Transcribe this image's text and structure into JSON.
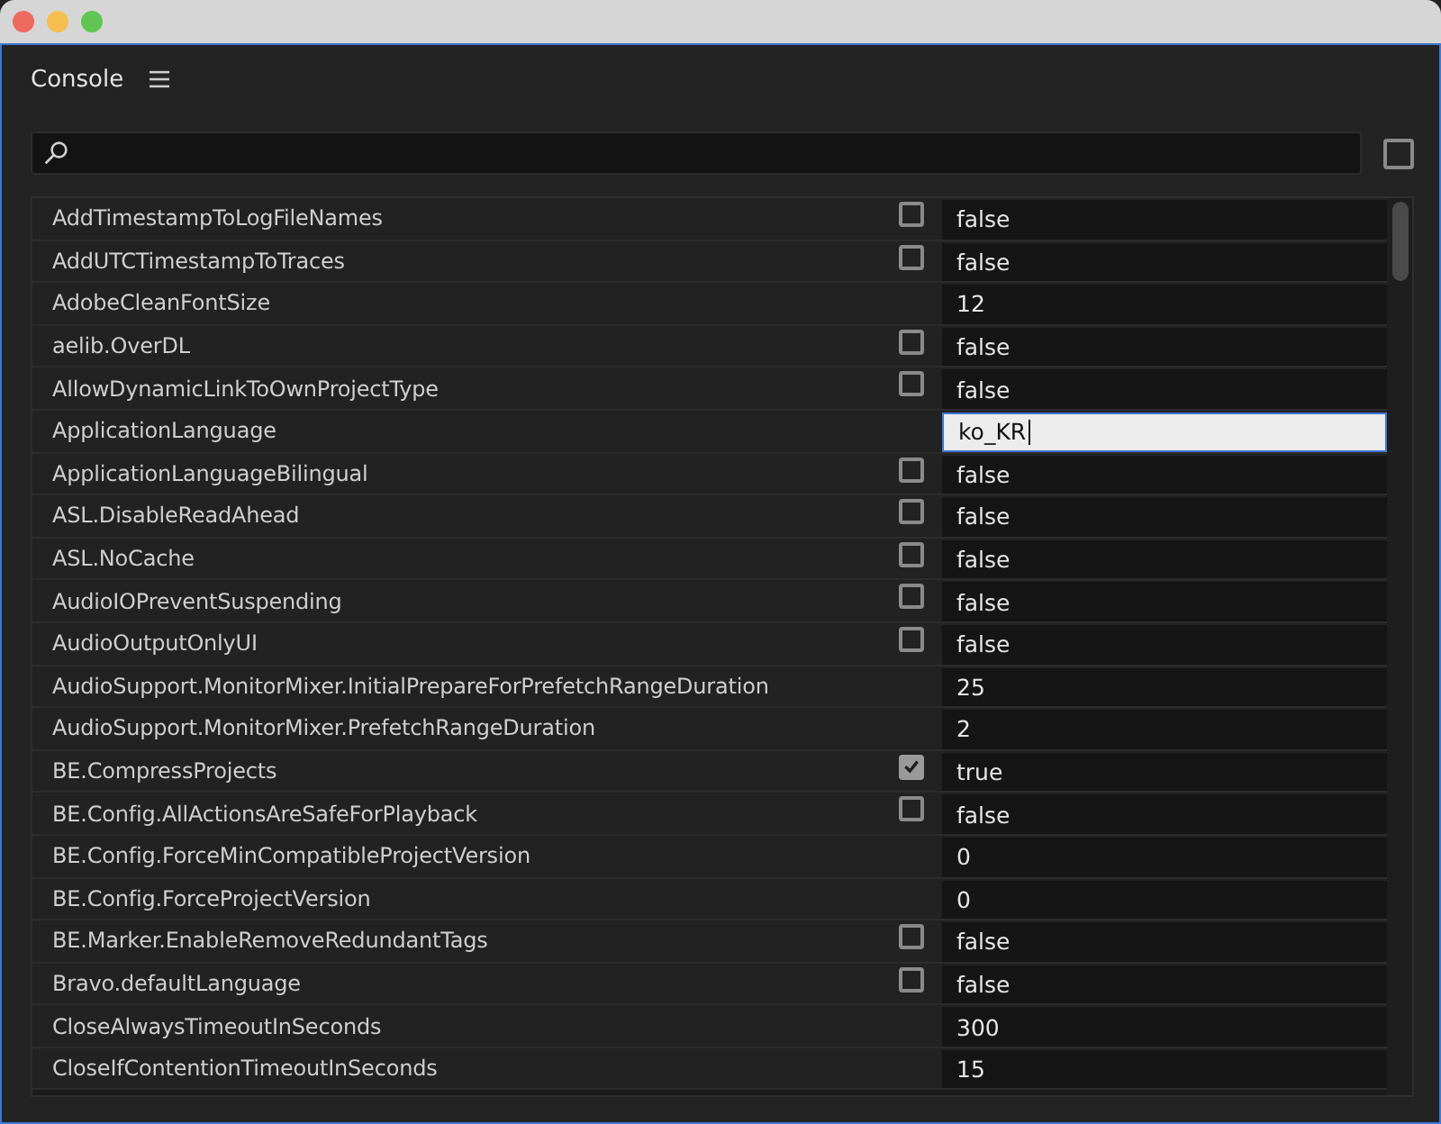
{
  "panel": {
    "title": "Console"
  },
  "filter_checkbox": {
    "checked": false
  },
  "rows": [
    {
      "name": "AddTimestampToLogFileNames",
      "kind": "bool",
      "checked": false,
      "value": "false",
      "focused": false
    },
    {
      "name": "AddUTCTimestampToTraces",
      "kind": "bool",
      "checked": false,
      "value": "false",
      "focused": false
    },
    {
      "name": "AdobeCleanFontSize",
      "kind": "text",
      "value": "12",
      "focused": false
    },
    {
      "name": "aelib.OverDL",
      "kind": "bool",
      "checked": false,
      "value": "false",
      "focused": false
    },
    {
      "name": "AllowDynamicLinkToOwnProjectType",
      "kind": "bool",
      "checked": false,
      "value": "false",
      "focused": false
    },
    {
      "name": "ApplicationLanguage",
      "kind": "text",
      "value": "ko_KR",
      "focused": true
    },
    {
      "name": "ApplicationLanguageBilingual",
      "kind": "bool",
      "checked": false,
      "value": "false",
      "focused": false
    },
    {
      "name": "ASL.DisableReadAhead",
      "kind": "bool",
      "checked": false,
      "value": "false",
      "focused": false
    },
    {
      "name": "ASL.NoCache",
      "kind": "bool",
      "checked": false,
      "value": "false",
      "focused": false
    },
    {
      "name": "AudioIOPreventSuspending",
      "kind": "bool",
      "checked": false,
      "value": "false",
      "focused": false
    },
    {
      "name": "AudioOutputOnlyUI",
      "kind": "bool",
      "checked": false,
      "value": "false",
      "focused": false
    },
    {
      "name": "AudioSupport.MonitorMixer.InitialPrepareForPrefetchRangeDuration",
      "kind": "text",
      "value": "25",
      "focused": false
    },
    {
      "name": "AudioSupport.MonitorMixer.PrefetchRangeDuration",
      "kind": "text",
      "value": "2",
      "focused": false
    },
    {
      "name": "BE.CompressProjects",
      "kind": "bool",
      "checked": true,
      "value": "true",
      "focused": false
    },
    {
      "name": "BE.Config.AllActionsAreSafeForPlayback",
      "kind": "bool",
      "checked": false,
      "value": "false",
      "focused": false
    },
    {
      "name": "BE.Config.ForceMinCompatibleProjectVersion",
      "kind": "text",
      "value": "0",
      "focused": false
    },
    {
      "name": "BE.Config.ForceProjectVersion",
      "kind": "text",
      "value": "0",
      "focused": false
    },
    {
      "name": "BE.Marker.EnableRemoveRedundantTags",
      "kind": "bool",
      "checked": false,
      "value": "false",
      "focused": false
    },
    {
      "name": "Bravo.defaultLanguage",
      "kind": "bool",
      "checked": false,
      "value": "false",
      "focused": false
    },
    {
      "name": "CloseAlwaysTimeoutInSeconds",
      "kind": "text",
      "value": "300",
      "focused": false
    },
    {
      "name": "CloseIfContentionTimeoutInSeconds",
      "kind": "text",
      "value": "15",
      "focused": false
    }
  ]
}
